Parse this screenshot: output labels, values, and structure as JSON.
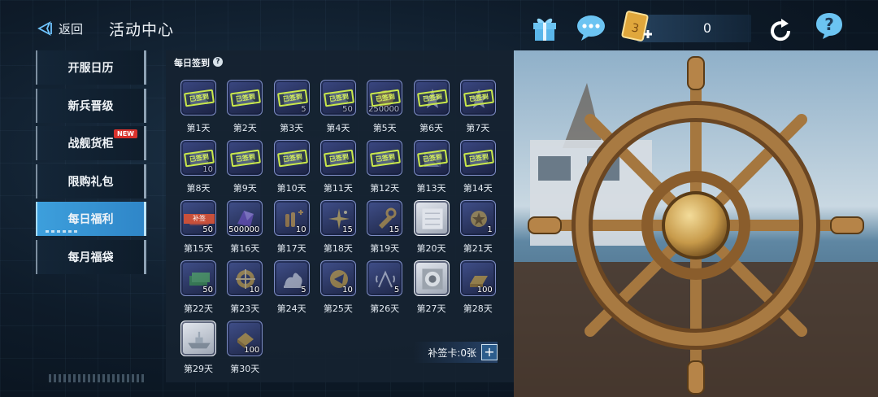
{
  "header": {
    "back_label": "返回",
    "title": "活动中心",
    "currency_value": "0",
    "icons": [
      "back-arrow-icon",
      "gift-icon",
      "chat-icon",
      "voucher-card-icon",
      "refresh-icon",
      "help-icon"
    ]
  },
  "sidebar": {
    "items": [
      {
        "label": "开服日历",
        "active": false
      },
      {
        "label": "新兵晋级",
        "active": false
      },
      {
        "label": "战舰货柜",
        "active": false,
        "badge": "NEW"
      },
      {
        "label": "限购礼包",
        "active": false
      },
      {
        "label": "每日福利",
        "active": true
      },
      {
        "label": "每月福袋",
        "active": false
      }
    ]
  },
  "panel": {
    "title": "每日签到",
    "help_icon": "?",
    "claimed_stamp": "已签到",
    "makeup_card_label": "补签卡:0张",
    "makeup_plus": "+",
    "days": [
      {
        "day": "第1天",
        "qty": "",
        "icon": "ticket-icon",
        "claimed": true
      },
      {
        "day": "第2天",
        "qty": "",
        "icon": "ticket-icon",
        "claimed": true
      },
      {
        "day": "第3天",
        "qty": "5",
        "icon": "ticket-icon",
        "claimed": true
      },
      {
        "day": "第4天",
        "qty": "50",
        "icon": "ticket-icon",
        "claimed": true
      },
      {
        "day": "第5天",
        "qty": "250000",
        "icon": "coin-icon",
        "claimed": true
      },
      {
        "day": "第6天",
        "qty": "",
        "icon": "star-icon",
        "claimed": true
      },
      {
        "day": "第7天",
        "qty": "",
        "icon": "star-icon",
        "claimed": true
      },
      {
        "day": "第8天",
        "qty": "10",
        "icon": "ticket-icon",
        "claimed": true
      },
      {
        "day": "第9天",
        "qty": "",
        "icon": "ticket-icon",
        "claimed": true
      },
      {
        "day": "第10天",
        "qty": "",
        "icon": "ticket-icon",
        "claimed": true
      },
      {
        "day": "第11天",
        "qty": "",
        "icon": "ticket-icon",
        "claimed": true
      },
      {
        "day": "第12天",
        "qty": "",
        "icon": "ticket-icon",
        "claimed": true
      },
      {
        "day": "第13天",
        "qty": "",
        "icon": "crate-icon",
        "claimed": true
      },
      {
        "day": "第14天",
        "qty": "",
        "icon": "ticket-icon",
        "claimed": true
      },
      {
        "day": "第15天",
        "qty": "50",
        "icon": "makeup-card-icon",
        "claimed": false,
        "tag": "补签"
      },
      {
        "day": "第16天",
        "qty": "500000",
        "icon": "crystal-icon",
        "claimed": false
      },
      {
        "day": "第17天",
        "qty": "10",
        "icon": "ammo-icon",
        "claimed": false
      },
      {
        "day": "第18天",
        "qty": "15",
        "icon": "sparkle-icon",
        "claimed": false
      },
      {
        "day": "第19天",
        "qty": "15",
        "icon": "wrench-icon",
        "claimed": false
      },
      {
        "day": "第20天",
        "qty": "",
        "icon": "blueprint-icon",
        "claimed": false
      },
      {
        "day": "第21天",
        "qty": "1",
        "icon": "medal-icon",
        "claimed": false
      },
      {
        "day": "第22天",
        "qty": "50",
        "icon": "cash-icon",
        "claimed": false
      },
      {
        "day": "第23天",
        "qty": "10",
        "icon": "target-icon",
        "claimed": false
      },
      {
        "day": "第24天",
        "qty": "5",
        "icon": "explosion-icon",
        "claimed": false
      },
      {
        "day": "第25天",
        "qty": "10",
        "icon": "shield-icon",
        "claimed": false
      },
      {
        "day": "第26天",
        "qty": "5",
        "icon": "radar-icon",
        "claimed": false
      },
      {
        "day": "第27天",
        "qty": "",
        "icon": "emblem-icon",
        "claimed": false
      },
      {
        "day": "第28天",
        "qty": "100",
        "icon": "gold-bar-icon",
        "claimed": false
      },
      {
        "day": "第29天",
        "qty": "",
        "icon": "warship-icon",
        "claimed": false
      },
      {
        "day": "第30天",
        "qty": "100",
        "icon": "gold-chest-icon",
        "claimed": false
      }
    ]
  },
  "scene": {
    "icon": "ship-wheel-illustration"
  }
}
